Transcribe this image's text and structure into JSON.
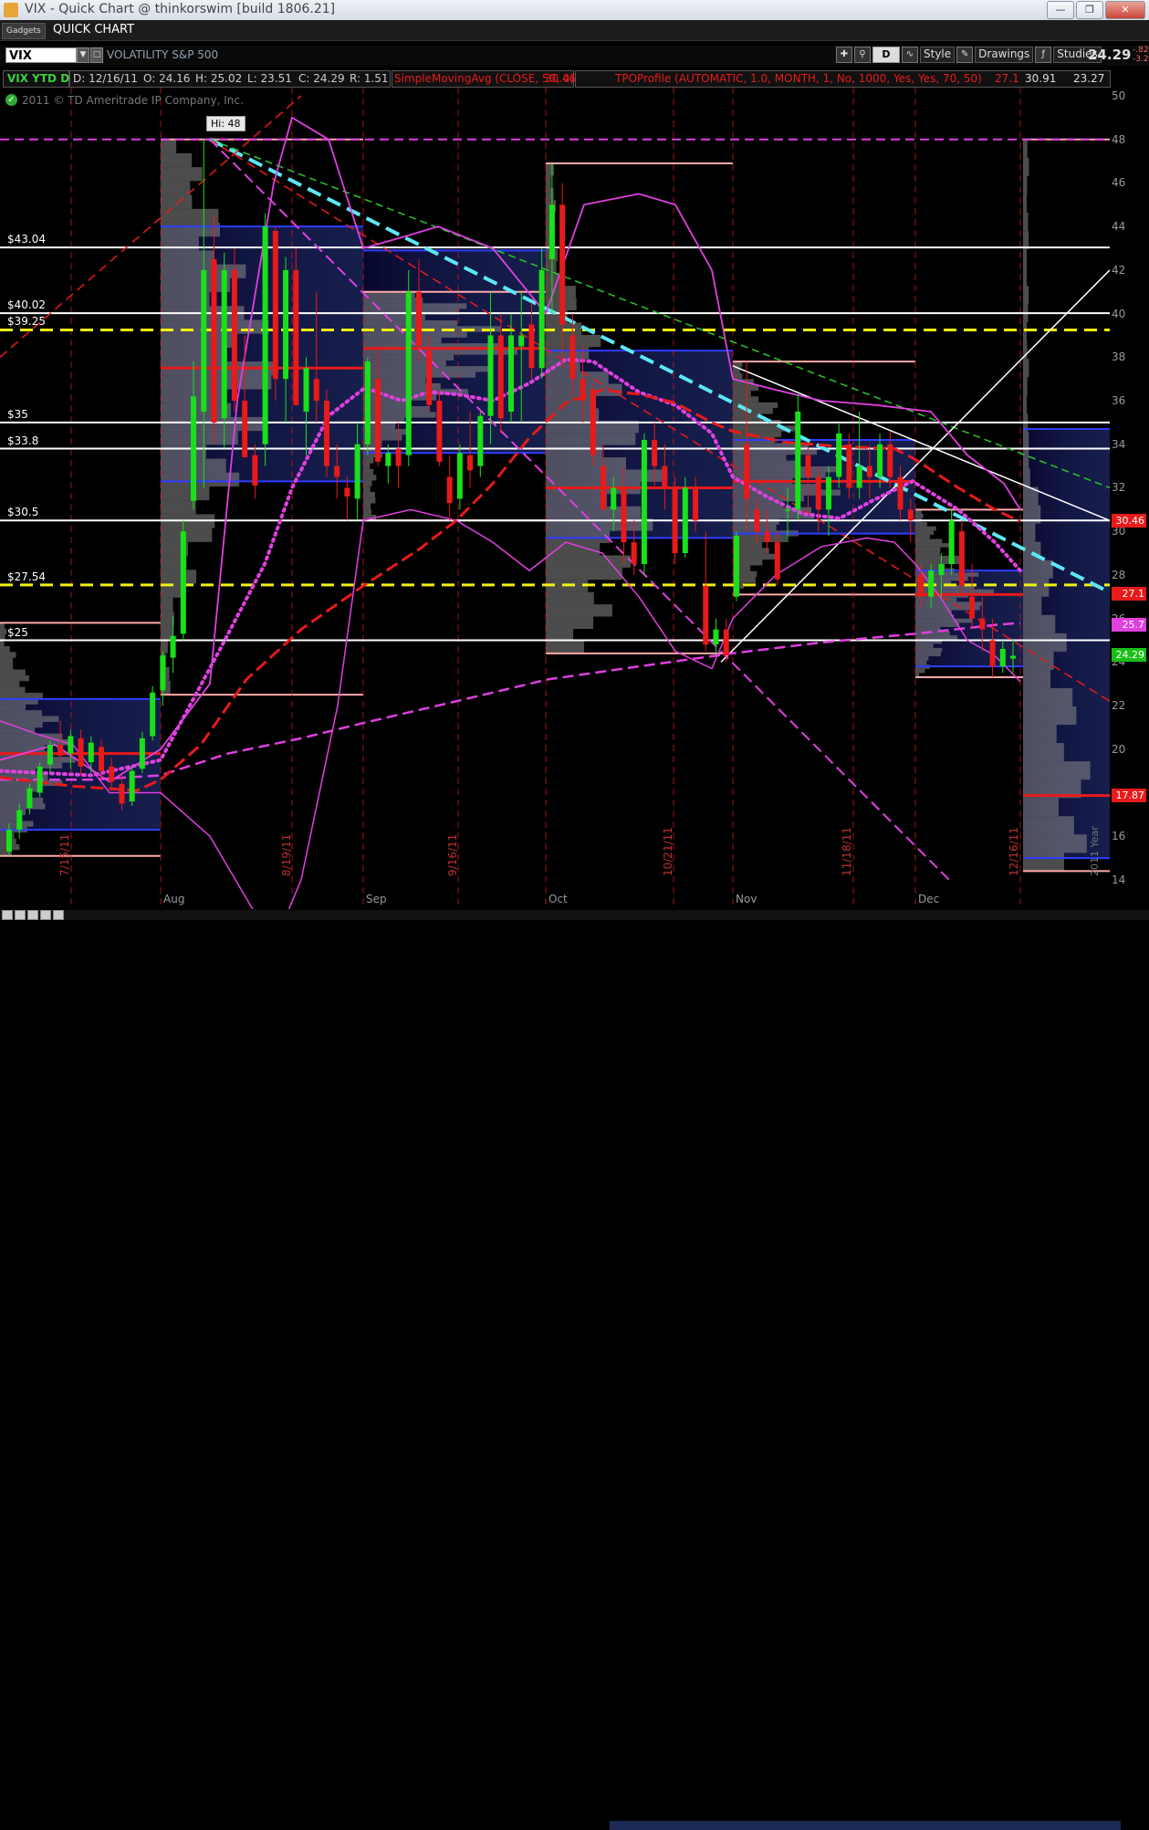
{
  "window": {
    "title": "VIX - Quick Chart @ thinkorswim [build 1806.21]",
    "min_icon": "minimize-icon",
    "max_icon": "restore-icon",
    "close_icon": "close-icon"
  },
  "gadget_bar": {
    "gadgets_label": "Gadgets",
    "title": "QUICK CHART"
  },
  "toolbar": {
    "symbol": "VIX",
    "description": "VOLATILITY S&P 500",
    "period": "D",
    "style_label": "Style",
    "drawings_label": "Drawings",
    "studies_label": "Studies",
    "last_price": "24.29",
    "change_1": "-.82",
    "change_2": "-3.2"
  },
  "study_header": {
    "symbol_period": "VIX YTD D",
    "date": "D: 12/16/11",
    "open": "O: 24.16",
    "high": "H: 25.02",
    "low": "L: 23.51",
    "close": "C: 24.29",
    "range": "R: 1.51",
    "sma_label": "SimpleMovingAvg (CLOSE, 50, 0)",
    "sma_value": "30.46",
    "tpo_label": "TPOProfile (AUTOMATIC, 1.0, MONTH, 1, No, 1000, Yes, Yes, 70, 50)",
    "tpo_value_1": "27.1",
    "tpo_value_2": "30.91",
    "tpo_value_3": "23.27"
  },
  "copyright": "2011 © TD Ameritrade IP Company, Inc.",
  "colors": {
    "up": "#19e119",
    "down": "#e81a1a",
    "sma": "#e81a1a",
    "poc": "#e81a1a",
    "vah_val": "#ffaaaa",
    "va_blue": "#2f3dff",
    "trend_cyan": "#5ce8f6",
    "magenta": "#e040e0",
    "yellow": "#f2f20a",
    "green_trend": "#28c828"
  },
  "chart_data": {
    "type": "candlestick",
    "title": "VIX YTD D",
    "ylim": [
      14,
      50
    ],
    "y_ticks": [
      14,
      16,
      18,
      20,
      22,
      24,
      26,
      28,
      30,
      32,
      34,
      36,
      38,
      40,
      42,
      44,
      46,
      48,
      50
    ],
    "x_ticks": [
      "Aug",
      "Sep",
      "Oct",
      "Nov",
      "Dec"
    ],
    "date_labels": [
      "7/15/11",
      "8/19/11",
      "9/16/11",
      "10/21/11",
      "11/18/11",
      "12/16/11"
    ],
    "year_label": "2011 Year",
    "high_annotation": "Hi: 48",
    "horizontal_levels": [
      {
        "label": "$43.04",
        "value": 43.04,
        "style": "white"
      },
      {
        "label": "$40.02",
        "value": 40.02,
        "style": "white"
      },
      {
        "label": "$39.25",
        "value": 39.25,
        "style": "yellow-dashed"
      },
      {
        "label": "$35",
        "value": 35,
        "style": "white"
      },
      {
        "label": "$33.8",
        "value": 33.8,
        "style": "white"
      },
      {
        "label": "$30.5",
        "value": 30.5,
        "style": "white"
      },
      {
        "label": "$27.54",
        "value": 27.54,
        "style": "yellow-dashed"
      },
      {
        "label": "$25",
        "value": 25,
        "style": "white"
      }
    ],
    "price_labels": [
      {
        "text": "30.46",
        "value": 30.46,
        "color": "#e81a1a"
      },
      {
        "text": "27.1",
        "value": 27.1,
        "color": "#e81a1a"
      },
      {
        "text": "25.7",
        "value": 25.7,
        "color": "#e040e0"
      },
      {
        "text": "24.29",
        "value": 24.29,
        "color": "#19c019"
      },
      {
        "text": "17.87",
        "value": 17.87,
        "color": "#e81a1a"
      }
    ],
    "tpo_profiles": [
      {
        "month": "Jul",
        "poc": 19.8,
        "vah": 22.3,
        "val": 16.3,
        "high": 25.8,
        "low": 15.1
      },
      {
        "month": "Aug",
        "poc": 37.5,
        "vah": 44.0,
        "val": 32.3,
        "high": 48.0,
        "low": 22.5
      },
      {
        "month": "Sep",
        "poc": 38.4,
        "vah": 42.9,
        "val": 33.6,
        "high": 41.0,
        "low": 30.5
      },
      {
        "month": "Oct",
        "poc": 32.0,
        "vah": 38.3,
        "val": 29.7,
        "high": 46.9,
        "low": 24.4
      },
      {
        "month": "Nov",
        "poc": 32.3,
        "vah": 34.2,
        "val": 29.9,
        "high": 37.8,
        "low": 27.1
      },
      {
        "month": "Dec",
        "poc": 27.1,
        "vah": 28.2,
        "val": 23.8,
        "high": 31.0,
        "low": 23.3
      },
      {
        "month": "YTD",
        "poc": 17.87,
        "vah": 34.7,
        "val": 15.0,
        "high": 48.0,
        "low": 14.4
      }
    ],
    "candles": [
      [
        15.3,
        16.6,
        15.1,
        16.3
      ],
      [
        16.3,
        17.5,
        15.9,
        17.2
      ],
      [
        17.3,
        18.4,
        17.0,
        18.2
      ],
      [
        18.0,
        19.4,
        17.8,
        19.2
      ],
      [
        19.3,
        20.4,
        18.9,
        20.2
      ],
      [
        20.2,
        21.3,
        19.5,
        19.7
      ],
      [
        19.8,
        20.9,
        19.1,
        20.6
      ],
      [
        20.5,
        20.9,
        18.8,
        19.2
      ],
      [
        19.4,
        20.6,
        18.9,
        20.3
      ],
      [
        20.1,
        20.4,
        18.6,
        19.0
      ],
      [
        19.2,
        19.6,
        18.1,
        18.5
      ],
      [
        18.4,
        18.8,
        17.2,
        17.5
      ],
      [
        17.6,
        19.2,
        17.4,
        19.0
      ],
      [
        19.1,
        20.8,
        18.9,
        20.5
      ],
      [
        20.6,
        22.9,
        20.4,
        22.6
      ],
      [
        22.7,
        24.5,
        22.0,
        24.3
      ],
      [
        24.2,
        26.1,
        23.5,
        25.2
      ],
      [
        25.3,
        30.5,
        25.0,
        30.0
      ],
      [
        31.4,
        37.8,
        31.0,
        36.2
      ],
      [
        35.5,
        48.0,
        32.0,
        42.0
      ],
      [
        42.5,
        44.5,
        34.0,
        35.0
      ],
      [
        35.2,
        42.8,
        33.8,
        42.0
      ],
      [
        42.0,
        43.0,
        35.5,
        36.0
      ],
      [
        36.0,
        39.0,
        33.5,
        33.4
      ],
      [
        33.5,
        34.0,
        31.5,
        32.1
      ],
      [
        34.0,
        44.6,
        33.0,
        44.0
      ],
      [
        43.8,
        44.0,
        36.0,
        37.0
      ],
      [
        37.0,
        42.6,
        35.0,
        42.0
      ],
      [
        42.0,
        43.0,
        36.0,
        35.8
      ],
      [
        35.5,
        38.0,
        33.5,
        37.5
      ],
      [
        37.0,
        41.0,
        35.0,
        36.0
      ],
      [
        36.0,
        36.5,
        32.5,
        33.0
      ],
      [
        33.0,
        34.0,
        31.5,
        32.5
      ],
      [
        32.0,
        32.5,
        30.5,
        31.6
      ],
      [
        31.5,
        35.0,
        30.5,
        34.0
      ],
      [
        34.0,
        38.0,
        33.5,
        37.8
      ],
      [
        37.0,
        38.5,
        33.0,
        33.2
      ],
      [
        33.0,
        34.0,
        32.2,
        33.6
      ],
      [
        33.8,
        35.0,
        32.0,
        33.0
      ],
      [
        33.5,
        42.0,
        33.0,
        41.0
      ],
      [
        41.0,
        42.5,
        37.8,
        38.5
      ],
      [
        38.3,
        39.0,
        35.5,
        35.8
      ],
      [
        36.0,
        36.5,
        33.0,
        33.2
      ],
      [
        32.5,
        33.5,
        30.5,
        31.3
      ],
      [
        31.5,
        34.0,
        31.0,
        33.6
      ],
      [
        33.5,
        35.5,
        32.0,
        32.8
      ],
      [
        33.0,
        35.5,
        32.5,
        35.3
      ],
      [
        35.3,
        41.0,
        34.0,
        39.0
      ],
      [
        39.0,
        40.0,
        34.5,
        35.2
      ],
      [
        35.5,
        40.0,
        35.0,
        39.0
      ],
      [
        38.5,
        41.0,
        35.0,
        39.0
      ],
      [
        39.5,
        40.5,
        37.0,
        37.5
      ],
      [
        37.5,
        43.0,
        37.0,
        42.0
      ],
      [
        42.5,
        46.9,
        40.0,
        45.0
      ],
      [
        45.0,
        46.0,
        37.5,
        39.5
      ],
      [
        39.0,
        40.0,
        36.0,
        37.0
      ],
      [
        37.0,
        38.5,
        35.0,
        36.0
      ],
      [
        36.5,
        36.8,
        33.0,
        33.5
      ],
      [
        33.0,
        34.0,
        31.5,
        31.0
      ],
      [
        31.0,
        32.5,
        30.0,
        32.0
      ],
      [
        32.0,
        33.0,
        28.5,
        29.5
      ],
      [
        29.5,
        30.5,
        28.0,
        28.5
      ],
      [
        28.5,
        34.5,
        28.0,
        34.2
      ],
      [
        34.2,
        35.0,
        32.0,
        33.0
      ],
      [
        33.0,
        34.0,
        31.0,
        32.0
      ],
      [
        32.0,
        32.5,
        28.5,
        29.0
      ],
      [
        29.0,
        32.5,
        28.8,
        32.0
      ],
      [
        32.0,
        32.5,
        30.0,
        30.5
      ],
      [
        27.5,
        30.0,
        24.5,
        24.8
      ],
      [
        24.8,
        26.0,
        24.4,
        25.5
      ],
      [
        25.5,
        26.0,
        24.0,
        24.3
      ],
      [
        27.0,
        30.0,
        26.8,
        29.8
      ],
      [
        34.0,
        37.8,
        30.0,
        31.5
      ],
      [
        31.0,
        31.5,
        29.5,
        30.0
      ],
      [
        30.0,
        31.0,
        29.0,
        29.5
      ],
      [
        29.5,
        30.0,
        27.5,
        27.8
      ],
      [
        31.0,
        32.0,
        29.5,
        31.0
      ],
      [
        31.0,
        36.3,
        30.5,
        35.5
      ],
      [
        33.5,
        34.0,
        31.0,
        32.5
      ],
      [
        32.5,
        33.0,
        30.0,
        31.0
      ],
      [
        31.0,
        33.0,
        29.8,
        32.5
      ],
      [
        32.5,
        35.0,
        32.0,
        34.5
      ],
      [
        34.0,
        34.5,
        31.5,
        32.0
      ],
      [
        32.0,
        35.5,
        31.5,
        33.0
      ],
      [
        33.0,
        34.0,
        31.5,
        32.5
      ],
      [
        32.5,
        34.5,
        32.0,
        34.0
      ],
      [
        34.0,
        34.6,
        32.0,
        32.5
      ],
      [
        32.5,
        33.0,
        30.5,
        31.0
      ],
      [
        31.0,
        31.5,
        29.5,
        30.5
      ],
      [
        28.0,
        28.5,
        26.5,
        27.0
      ],
      [
        27.0,
        28.5,
        26.5,
        28.2
      ],
      [
        28.0,
        29.0,
        27.0,
        28.5
      ],
      [
        28.5,
        31.0,
        28.0,
        30.5
      ],
      [
        30.0,
        30.5,
        27.0,
        27.5
      ],
      [
        27.0,
        28.5,
        25.5,
        26.0
      ],
      [
        26.0,
        27.0,
        24.5,
        25.5
      ],
      [
        25.0,
        26.0,
        23.3,
        23.8
      ],
      [
        23.8,
        25.0,
        23.5,
        24.6
      ],
      [
        24.16,
        25.02,
        23.51,
        24.29
      ]
    ]
  }
}
